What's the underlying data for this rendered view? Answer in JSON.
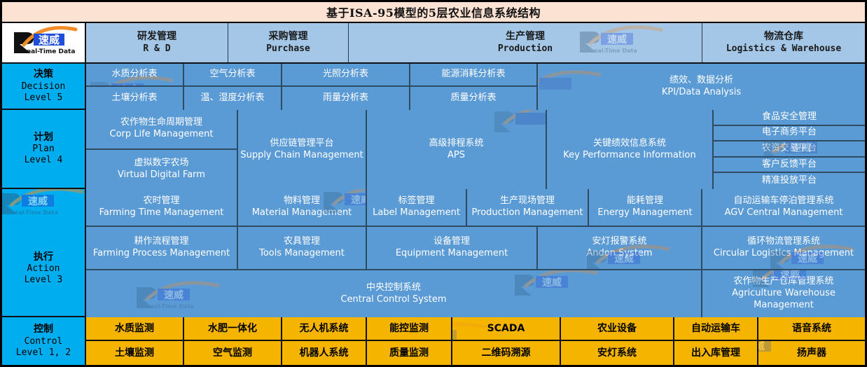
{
  "title": "基于ISA-95模型的5层农业信息系统结构",
  "logo": {
    "letter": "R",
    "badge": "速威",
    "tagline": "eal-Time Data",
    "colors": {
      "arc": "#F28C28",
      "badge": "#1F4FD8",
      "letter": "#111111"
    }
  },
  "colors": {
    "title_bg": "#FBE2D2",
    "header_bg": "#A4C6E7",
    "level_bg": "#00AEEF",
    "cell_bg": "#5B9BD5",
    "control_bg": "#F4B400",
    "border": "#111111"
  },
  "header": {
    "columns": [
      {
        "cn": "研发管理",
        "en": "R & D"
      },
      {
        "cn": "采购管理",
        "en": "Purchase"
      },
      {
        "cn": "生产管理",
        "en": "Production"
      },
      {
        "cn": "物流仓库",
        "en": "Logistics & Warehouse"
      }
    ]
  },
  "levels": [
    {
      "cn": "决策",
      "en": "Decision",
      "level": "Level 5"
    },
    {
      "cn": "计划",
      "en": "Plan",
      "level": "Level 4"
    },
    {
      "cn": "执行",
      "en": "Action",
      "level": "Level 3"
    },
    {
      "cn": "控制",
      "en": "Control",
      "level": "Level 1, 2"
    }
  ],
  "decision": {
    "pairs": [
      {
        "top": "水质分析表",
        "bottom": "土壤分析表"
      },
      {
        "top": "空气分析表",
        "bottom": "温、湿度分析表"
      },
      {
        "top": "光照分析表",
        "bottom": "雨量分析表"
      },
      {
        "top": "能源消耗分析表",
        "bottom": "质量分析表"
      }
    ],
    "kpi": {
      "cn": "绩效、数据分析",
      "en": "KPI/Data Analysis"
    }
  },
  "plan": {
    "rd": [
      {
        "cn": "农作物生命周期管理",
        "en": "Corp Life Management"
      },
      {
        "cn": "虚拟数字农场",
        "en": "Virtual Digital Farm"
      }
    ],
    "supply": {
      "cn": "供应链管理平台",
      "en": "Supply Chain Management"
    },
    "aps": {
      "cn": "高级排程系统",
      "en": "APS"
    },
    "kpi": {
      "cn": "关键绩效信息系统",
      "en": "Key Performance Information"
    },
    "logistics": [
      "食品安全管理",
      "电子商务平台",
      "农资交易平台",
      "客户反馈平台",
      "精准投放平台"
    ]
  },
  "action": {
    "row1": [
      {
        "cn": "农时管理",
        "en": "Farming Time Management"
      },
      {
        "cn": "物料管理",
        "en": "Material Management"
      },
      {
        "cn": "标签管理",
        "en": "Label Management"
      },
      {
        "cn": "生产现场管理",
        "en": "Production Management"
      },
      {
        "cn": "能耗管理",
        "en": "Energy Management"
      },
      {
        "cn": "自动运输车停泊管理系统",
        "en": "AGV Central Management"
      }
    ],
    "row2": [
      {
        "cn": "耕作流程管理",
        "en": "Farming Process Management"
      },
      {
        "cn": "农具管理",
        "en": "Tools Management"
      },
      {
        "cn": "设备管理",
        "en": "Equipment Management"
      },
      {
        "cn": "安灯报警系统",
        "en": "Andon System"
      },
      {
        "cn": "循环物流管理系统",
        "en": "Circular Logistics Management"
      }
    ],
    "row3": [
      {
        "cn": "中央控制系统",
        "en": "Central Control System"
      },
      {
        "cn": "农作物生产仓库管理系统",
        "en": "Agriculture Warehouse Management"
      }
    ]
  },
  "control": {
    "row1": [
      "水质监测",
      "水肥一体化",
      "无人机系统",
      "能控监测",
      "SCADA",
      "农业设备",
      "自动运输车",
      "语音系统"
    ],
    "row2": [
      "土壤监测",
      "空气监测",
      "机器人系统",
      "质量监测",
      "二维码溯源",
      "安灯系统",
      "出入库管理",
      "扬声器"
    ]
  }
}
